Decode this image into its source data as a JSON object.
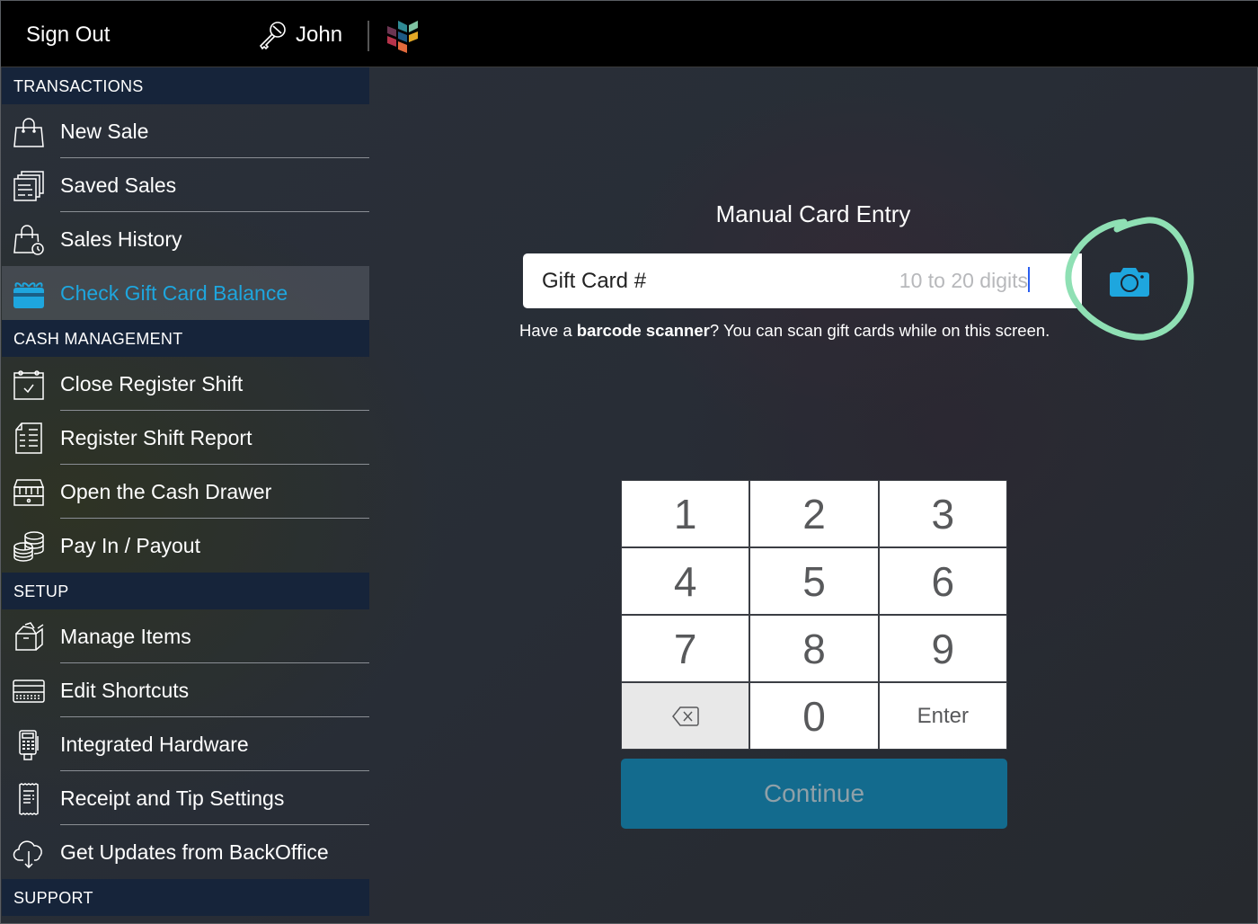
{
  "topbar": {
    "sign_out_label": "Sign Out",
    "user_name": "John",
    "user_icon": "key-icon",
    "logo_icon": "brand-logo-icon",
    "logo_colors": [
      "#6b3552",
      "#2f8a94",
      "#7fc3a2",
      "#b7334a",
      "#1e5a84",
      "#e3a826",
      "#e26a3c"
    ]
  },
  "sidebar": {
    "sections": [
      {
        "header": "TRANSACTIONS",
        "items": [
          {
            "label": "New Sale",
            "icon": "shopping-bag-icon",
            "active": false
          },
          {
            "label": "Saved Sales",
            "icon": "stacked-documents-icon",
            "active": false
          },
          {
            "label": "Sales History",
            "icon": "bag-clock-icon",
            "active": false
          },
          {
            "label": "Check Gift Card Balance",
            "icon": "gift-card-icon",
            "active": true
          }
        ]
      },
      {
        "header": "CASH MANAGEMENT",
        "items": [
          {
            "label": "Close Register Shift",
            "icon": "calendar-check-icon",
            "active": false
          },
          {
            "label": "Register Shift Report",
            "icon": "report-icon",
            "active": false
          },
          {
            "label": "Open the Cash Drawer",
            "icon": "cash-drawer-icon",
            "active": false
          },
          {
            "label": "Pay In / Payout",
            "icon": "coins-icon",
            "active": false
          }
        ]
      },
      {
        "header": "SETUP",
        "items": [
          {
            "label": "Manage Items",
            "icon": "box-icon",
            "active": false
          },
          {
            "label": "Edit Shortcuts",
            "icon": "keyboard-icon",
            "active": false
          },
          {
            "label": "Integrated Hardware",
            "icon": "card-terminal-icon",
            "active": false
          },
          {
            "label": "Receipt and Tip Settings",
            "icon": "receipt-icon",
            "active": false
          },
          {
            "label": "Get Updates from BackOffice",
            "icon": "cloud-download-icon",
            "active": false
          }
        ]
      },
      {
        "header": "SUPPORT",
        "items": []
      }
    ]
  },
  "main": {
    "title": "Manual Card Entry",
    "input": {
      "label": "Gift Card #",
      "value": "",
      "placeholder": "10 to 20 digits"
    },
    "camera_icon": "camera-icon",
    "hint_prefix": "Have a ",
    "hint_bold": "barcode scanner",
    "hint_suffix": "? You can scan gift cards while on this screen.",
    "keypad": {
      "keys": [
        "1",
        "2",
        "3",
        "4",
        "5",
        "6",
        "7",
        "8",
        "9",
        "",
        "0",
        "Enter"
      ],
      "backspace_icon": "backspace-icon"
    },
    "continue_label": "Continue"
  },
  "colors": {
    "accent": "#1ea6de",
    "section_header_bg": "#16243a",
    "continue_bg": "#136b8e",
    "highlight_ring": "#8fe0b4"
  }
}
